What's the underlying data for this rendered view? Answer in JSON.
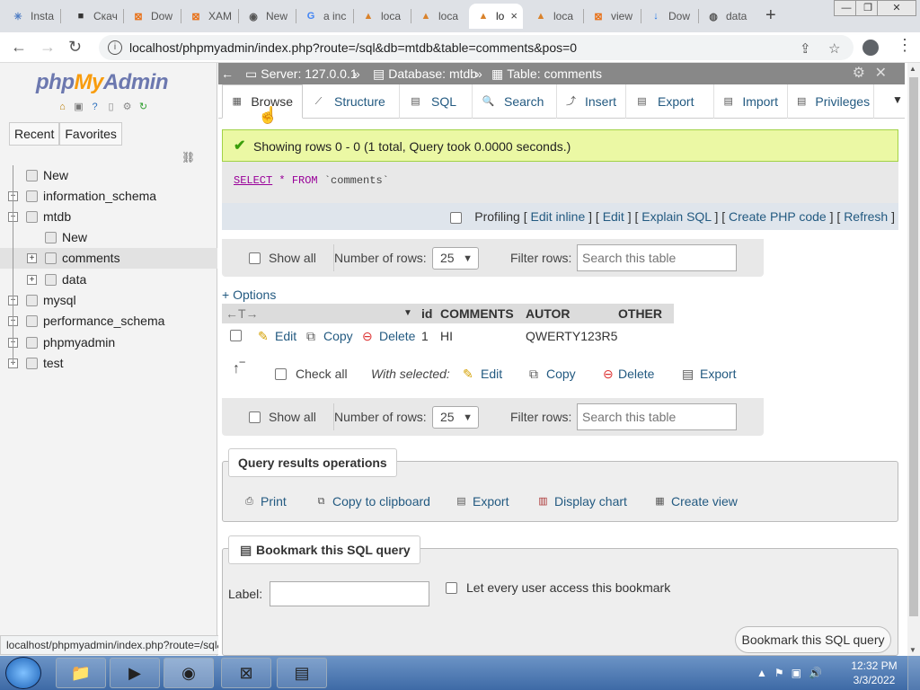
{
  "browser": {
    "tabs": [
      {
        "title": "Insta",
        "fav": "✳"
      },
      {
        "title": "Скач",
        "fav": "■"
      },
      {
        "title": "Dow",
        "fav": "⊠"
      },
      {
        "title": "XAM",
        "fav": "⊠"
      },
      {
        "title": "New",
        "fav": "◉"
      },
      {
        "title": "a inc",
        "fav": "G"
      },
      {
        "title": "loca",
        "fav": "▲"
      },
      {
        "title": "loca",
        "fav": "▲"
      },
      {
        "title": "lo",
        "fav": "▲"
      },
      {
        "title": "loca",
        "fav": "▲"
      },
      {
        "title": "view",
        "fav": "⊠"
      },
      {
        "title": "Dow",
        "fav": "↓"
      },
      {
        "title": "data",
        "fav": "◍"
      }
    ],
    "new_tab": "+",
    "close_tab": "×",
    "url": "localhost/phpmyadmin/index.php?route=/sql&db=mtdb&table=comments&pos=0",
    "status_url": "localhost/phpmyadmin/index.php?route=/sql&db=mtdb&t..."
  },
  "sidebar": {
    "logo": {
      "php": "php",
      "my": "My",
      "admin": "Admin"
    },
    "recent": "Recent",
    "favorites": "Favorites",
    "tree": [
      {
        "label": "New",
        "level": 0
      },
      {
        "label": "information_schema",
        "level": 0
      },
      {
        "label": "mtdb",
        "level": 0
      },
      {
        "label": "New",
        "level": 1
      },
      {
        "label": "comments",
        "level": 1
      },
      {
        "label": "data",
        "level": 1
      },
      {
        "label": "mysql",
        "level": 0
      },
      {
        "label": "performance_schema",
        "level": 0
      },
      {
        "label": "phpmyadmin",
        "level": 0
      },
      {
        "label": "test",
        "level": 0
      }
    ]
  },
  "breadcrumb": {
    "server": "Server: 127.0.0.1",
    "database": "Database: mtdb",
    "table": "Table: comments",
    "sep": "»"
  },
  "menu": [
    "Browse",
    "Structure",
    "SQL",
    "Search",
    "Insert",
    "Export",
    "Import",
    "Privileges"
  ],
  "message": "Showing rows 0 - 0 (1 total, Query took 0.0000 seconds.)",
  "sql": {
    "select": "SELECT",
    "star": "*",
    "from": "FROM",
    "table": "`comments`"
  },
  "profiling": {
    "label": "Profiling",
    "links": [
      "Edit inline",
      "Edit",
      "Explain SQL",
      "Create PHP code",
      "Refresh"
    ]
  },
  "navbar": {
    "show_all": "Show all",
    "num_rows_label": "Number of rows:",
    "num_rows_value": "25",
    "filter_label": "Filter rows:",
    "filter_placeholder": "Search this table"
  },
  "options": "+ Options",
  "table": {
    "columns": [
      "id",
      "COMMENTS",
      "AUTOR",
      "OTHER"
    ],
    "row": {
      "edit": "Edit",
      "copy": "Copy",
      "delete": "Delete",
      "id": "1",
      "comments": "HI",
      "autor": "QWERTY123R5",
      "other": ""
    }
  },
  "bulk": {
    "check_all": "Check all",
    "with_selected": "With selected:",
    "edit": "Edit",
    "copy": "Copy",
    "delete": "Delete",
    "export": "Export"
  },
  "query_ops": {
    "title": "Query results operations",
    "print": "Print",
    "copy_clipboard": "Copy to clipboard",
    "export": "Export",
    "display_chart": "Display chart",
    "create_view": "Create view"
  },
  "bookmark": {
    "title": "Bookmark this SQL query",
    "label": "Label:",
    "every_user": "Let every user access this bookmark",
    "button": "Bookmark this SQL query"
  },
  "taskbar": {
    "time": "12:32 PM",
    "date": "3/3/2022"
  },
  "colors": {
    "link": "#235a81",
    "success_bg": "#ebf8a4",
    "topbar": "#888888"
  }
}
